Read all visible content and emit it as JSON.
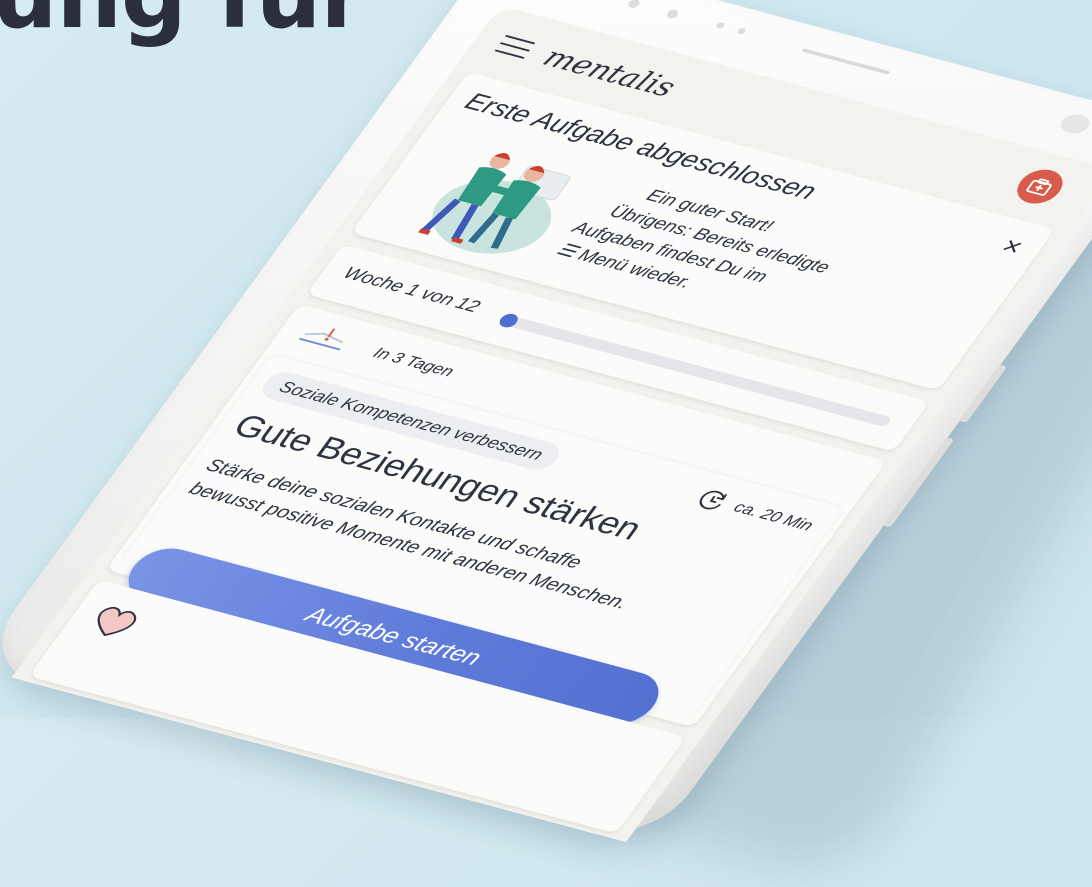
{
  "page": {
    "headline": "ung für"
  },
  "app": {
    "title": "mentalis",
    "emergency_icon": "first-aid-kit-icon"
  },
  "notification": {
    "title": "Erste Aufgabe abgeschlossen",
    "close_label": "×",
    "lines": [
      "Ein guter Start!",
      "Übrigens: Bereits erledigte",
      "Aufgaben findest Du im",
      "☰ Menü wieder."
    ]
  },
  "progress": {
    "label": "Woche 1 von 12",
    "current_week": 1,
    "total_weeks": 12
  },
  "task": {
    "when": "In 3 Tagen",
    "category": "Soziale Kompetenzen verbessern",
    "duration": "ca. 20 Min",
    "title": "Gute Beziehungen stärken",
    "description": "Stärke deine sozialen Kontakte und schaffe bewusst positive Momente mit anderen Menschen.",
    "button_label": "Aufgabe starten"
  },
  "colors": {
    "accent": "#5d7ad9",
    "emergency": "#d95b4c",
    "text": "#2e3340",
    "background": "#d6ebf1"
  }
}
